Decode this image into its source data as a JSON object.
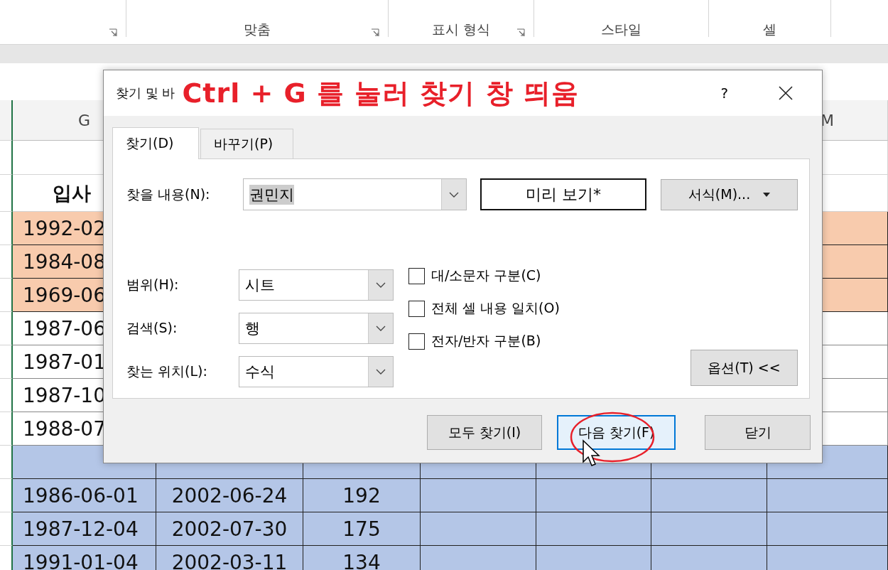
{
  "ribbon": {
    "groups": [
      {
        "launcher": true
      },
      {
        "label": "맞춤",
        "launcher": true
      },
      {
        "label": "표시 형식",
        "launcher": true
      },
      {
        "label": "스타일",
        "launcher": false
      },
      {
        "label": "셀",
        "launcher": false
      }
    ]
  },
  "sheet": {
    "columns": [
      {
        "header": "G"
      },
      {},
      {},
      {},
      {},
      {},
      {
        "header": "M"
      }
    ],
    "rows": [
      {
        "kind": "blank",
        "cells": []
      },
      {
        "kind": "header",
        "cells": [
          "입사"
        ]
      },
      {
        "kind": "data",
        "color": "#f8cbad",
        "cells": [
          "1992-02"
        ]
      },
      {
        "kind": "data",
        "color": "#f8cbad",
        "cells": [
          "1984-08"
        ]
      },
      {
        "kind": "data",
        "color": "#f8cbad",
        "cells": [
          "1969-06"
        ]
      },
      {
        "kind": "data",
        "color": "#ffffff",
        "cells": [
          "1987-06"
        ]
      },
      {
        "kind": "data",
        "color": "#ffffff",
        "cells": [
          "1987-01"
        ]
      },
      {
        "kind": "data",
        "color": "#ffffff",
        "cells": [
          "1987-10"
        ]
      },
      {
        "kind": "data",
        "color": "#ffffff",
        "cells": [
          "1988-07"
        ]
      },
      {
        "kind": "data",
        "color": "#b4c6e7",
        "cells": []
      },
      {
        "kind": "data",
        "color": "#b4c6e7",
        "cells": [
          "1986-06-01",
          "2002-06-24",
          "192"
        ]
      },
      {
        "kind": "data",
        "color": "#b4c6e7",
        "cells": [
          "1987-12-04",
          "2002-07-30",
          "175"
        ]
      },
      {
        "kind": "data",
        "color": "#b4c6e7",
        "cells": [
          "1991-01-04",
          "2002-03-11",
          "134"
        ]
      }
    ]
  },
  "dialog": {
    "title": "찾기 및 바",
    "annotation": "Ctrl + G 를 눌러 찾기 창 띄움",
    "help": "?",
    "tabs": [
      {
        "label": "찾기(D)",
        "selected": true
      },
      {
        "label": "바꾸기(P)",
        "selected": false
      }
    ],
    "find": {
      "label": "찾을 내용(N):",
      "value": "권민지"
    },
    "preview": "미리 보기*",
    "format_button": "서식(M)...",
    "options": [
      {
        "label": "범위(H):",
        "value": "시트"
      },
      {
        "label": "검색(S):",
        "value": "행"
      },
      {
        "label": "찾는 위치(L):",
        "value": "수식"
      }
    ],
    "checkboxes": [
      {
        "label": "대/소문자 구분(C)",
        "checked": false
      },
      {
        "label": "전체 셀 내용 일치(O)",
        "checked": false
      },
      {
        "label": "전자/반자 구분(B)",
        "checked": false
      }
    ],
    "options_button": "옵션(T) <<",
    "buttons": [
      {
        "label": "모두 찾기(I)",
        "focused": false
      },
      {
        "label": "다음 찾기(F)",
        "focused": true,
        "circled": true
      },
      {
        "label": "닫기",
        "focused": false
      }
    ]
  }
}
